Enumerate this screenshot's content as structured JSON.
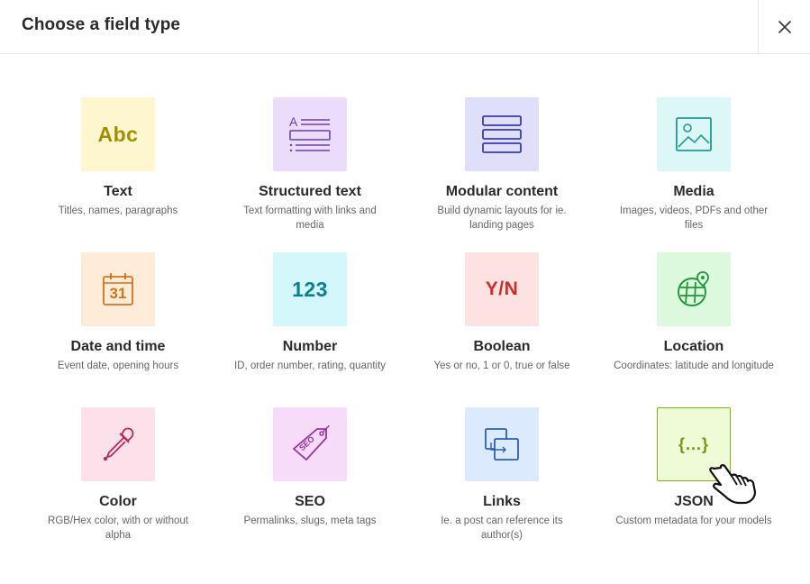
{
  "dialog": {
    "title": "Choose a field type",
    "close_icon": "close-icon"
  },
  "field_types": [
    {
      "label": "Text",
      "description": "Titles, names, paragraphs",
      "glyph": "Abc",
      "icon": "abc-icon",
      "tile_color": "#fdf6cf",
      "icon_color": "#a38e00"
    },
    {
      "label": "Structured text",
      "description": "Text formatting with links and media",
      "icon": "structured-text-icon",
      "tile_color": "#ecdcfb",
      "icon_color": "#6b3fa8"
    },
    {
      "label": "Modular content",
      "description": "Build dynamic layouts for ie. landing pages",
      "icon": "modular-blocks-icon",
      "tile_color": "#dfdffa",
      "icon_color": "#3b3bb0"
    },
    {
      "label": "Media",
      "description": "Images, videos, PDFs and other files",
      "icon": "image-icon",
      "tile_color": "#dcf7f5",
      "icon_color": "#1e9a94"
    },
    {
      "label": "Date and time",
      "description": "Event date, opening hours",
      "glyph": "31",
      "icon": "calendar-icon",
      "tile_color": "#feebd8",
      "icon_color": "#d4731a"
    },
    {
      "label": "Number",
      "description": "ID, order number, rating, quantity",
      "glyph": "123",
      "icon": "number-icon",
      "tile_color": "#d3f7fb",
      "icon_color": "#0b7f95"
    },
    {
      "label": "Boolean",
      "description": "Yes or no, 1 or 0, true or false",
      "glyph": "Y/N",
      "icon": "yes-no-icon",
      "tile_color": "#fde2e2",
      "icon_color": "#cc2e28"
    },
    {
      "label": "Location",
      "description": "Coordinates: latitude and longitude",
      "icon": "globe-pin-icon",
      "tile_color": "#dcf9dd",
      "icon_color": "#1f9a3a"
    },
    {
      "label": "Color",
      "description": "RGB/Hex color, with or without alpha",
      "icon": "eyedropper-icon",
      "tile_color": "#fde1ea",
      "icon_color": "#b8285a"
    },
    {
      "label": "SEO",
      "description": "Permalinks, slugs, meta tags",
      "glyph": "SEO",
      "icon": "seo-tag-icon",
      "tile_color": "#f6dcf9",
      "icon_color": "#9a2fa8"
    },
    {
      "label": "Links",
      "description": "Ie. a post can reference its author(s)",
      "icon": "link-reference-icon",
      "tile_color": "#dceafd",
      "icon_color": "#2c5fb0"
    },
    {
      "label": "JSON",
      "description": "Custom metadata for your models",
      "glyph": "{...}",
      "icon": "json-braces-icon",
      "tile_color": "#eefbd6",
      "icon_color": "#6f9a0c",
      "tile_border": "#7fb41a"
    }
  ],
  "cursor": {
    "icon": "hand-pointer-icon"
  }
}
